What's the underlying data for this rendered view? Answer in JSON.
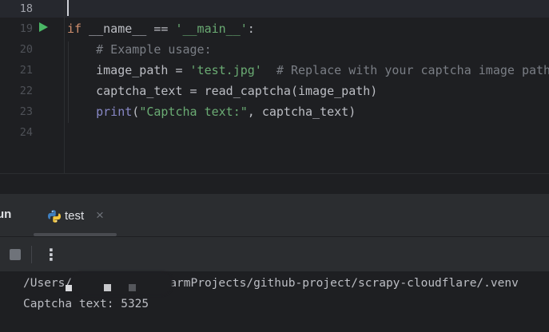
{
  "editor": {
    "lines": [
      {
        "num": "18",
        "code": []
      },
      {
        "num": "19",
        "code": [
          {
            "t": "if",
            "c": "kw"
          },
          {
            "t": " __name__ == ",
            "c": ""
          },
          {
            "t": "'__main__'",
            "c": "str"
          },
          {
            "t": ":",
            "c": ""
          }
        ]
      },
      {
        "num": "20",
        "code": [
          {
            "t": "    ",
            "c": ""
          },
          {
            "t": "# Example usage:",
            "c": "cmt"
          }
        ]
      },
      {
        "num": "21",
        "code": [
          {
            "t": "    image_path = ",
            "c": ""
          },
          {
            "t": "'test.jpg'",
            "c": "str"
          },
          {
            "t": "  ",
            "c": ""
          },
          {
            "t": "# Replace with your captcha image path",
            "c": "cmt"
          }
        ]
      },
      {
        "num": "22",
        "code": [
          {
            "t": "    captcha_text = read_captcha(image_path)",
            "c": ""
          }
        ]
      },
      {
        "num": "23",
        "code": [
          {
            "t": "    ",
            "c": ""
          },
          {
            "t": "print",
            "c": "bi"
          },
          {
            "t": "(",
            "c": ""
          },
          {
            "t": "\"Captcha text:\"",
            "c": "str"
          },
          {
            "t": ", captcha_text)",
            "c": ""
          }
        ]
      },
      {
        "num": "24",
        "code": []
      }
    ],
    "run_gutter_icon": "run-triangle-icon"
  },
  "tool_window": {
    "title": "un",
    "tab": {
      "label": "test",
      "icon": "python-icon",
      "close": "×"
    },
    "toolbar": {
      "stop_icon": "stop-icon",
      "more_icon": "more-vertical-icon",
      "more_glyph": "⋮"
    }
  },
  "console": {
    "lines": [
      "/Users/            charmProjects/github-project/scrapy-cloudflare/.venv",
      "Captcha text: 5325"
    ]
  },
  "colors": {
    "background": "#1e1f22",
    "panel": "#2b2d30",
    "keyword": "#cf8e6d",
    "string": "#6aab73",
    "comment": "#7a7e85",
    "builtin": "#8888c6",
    "run_green": "#4ab866"
  }
}
